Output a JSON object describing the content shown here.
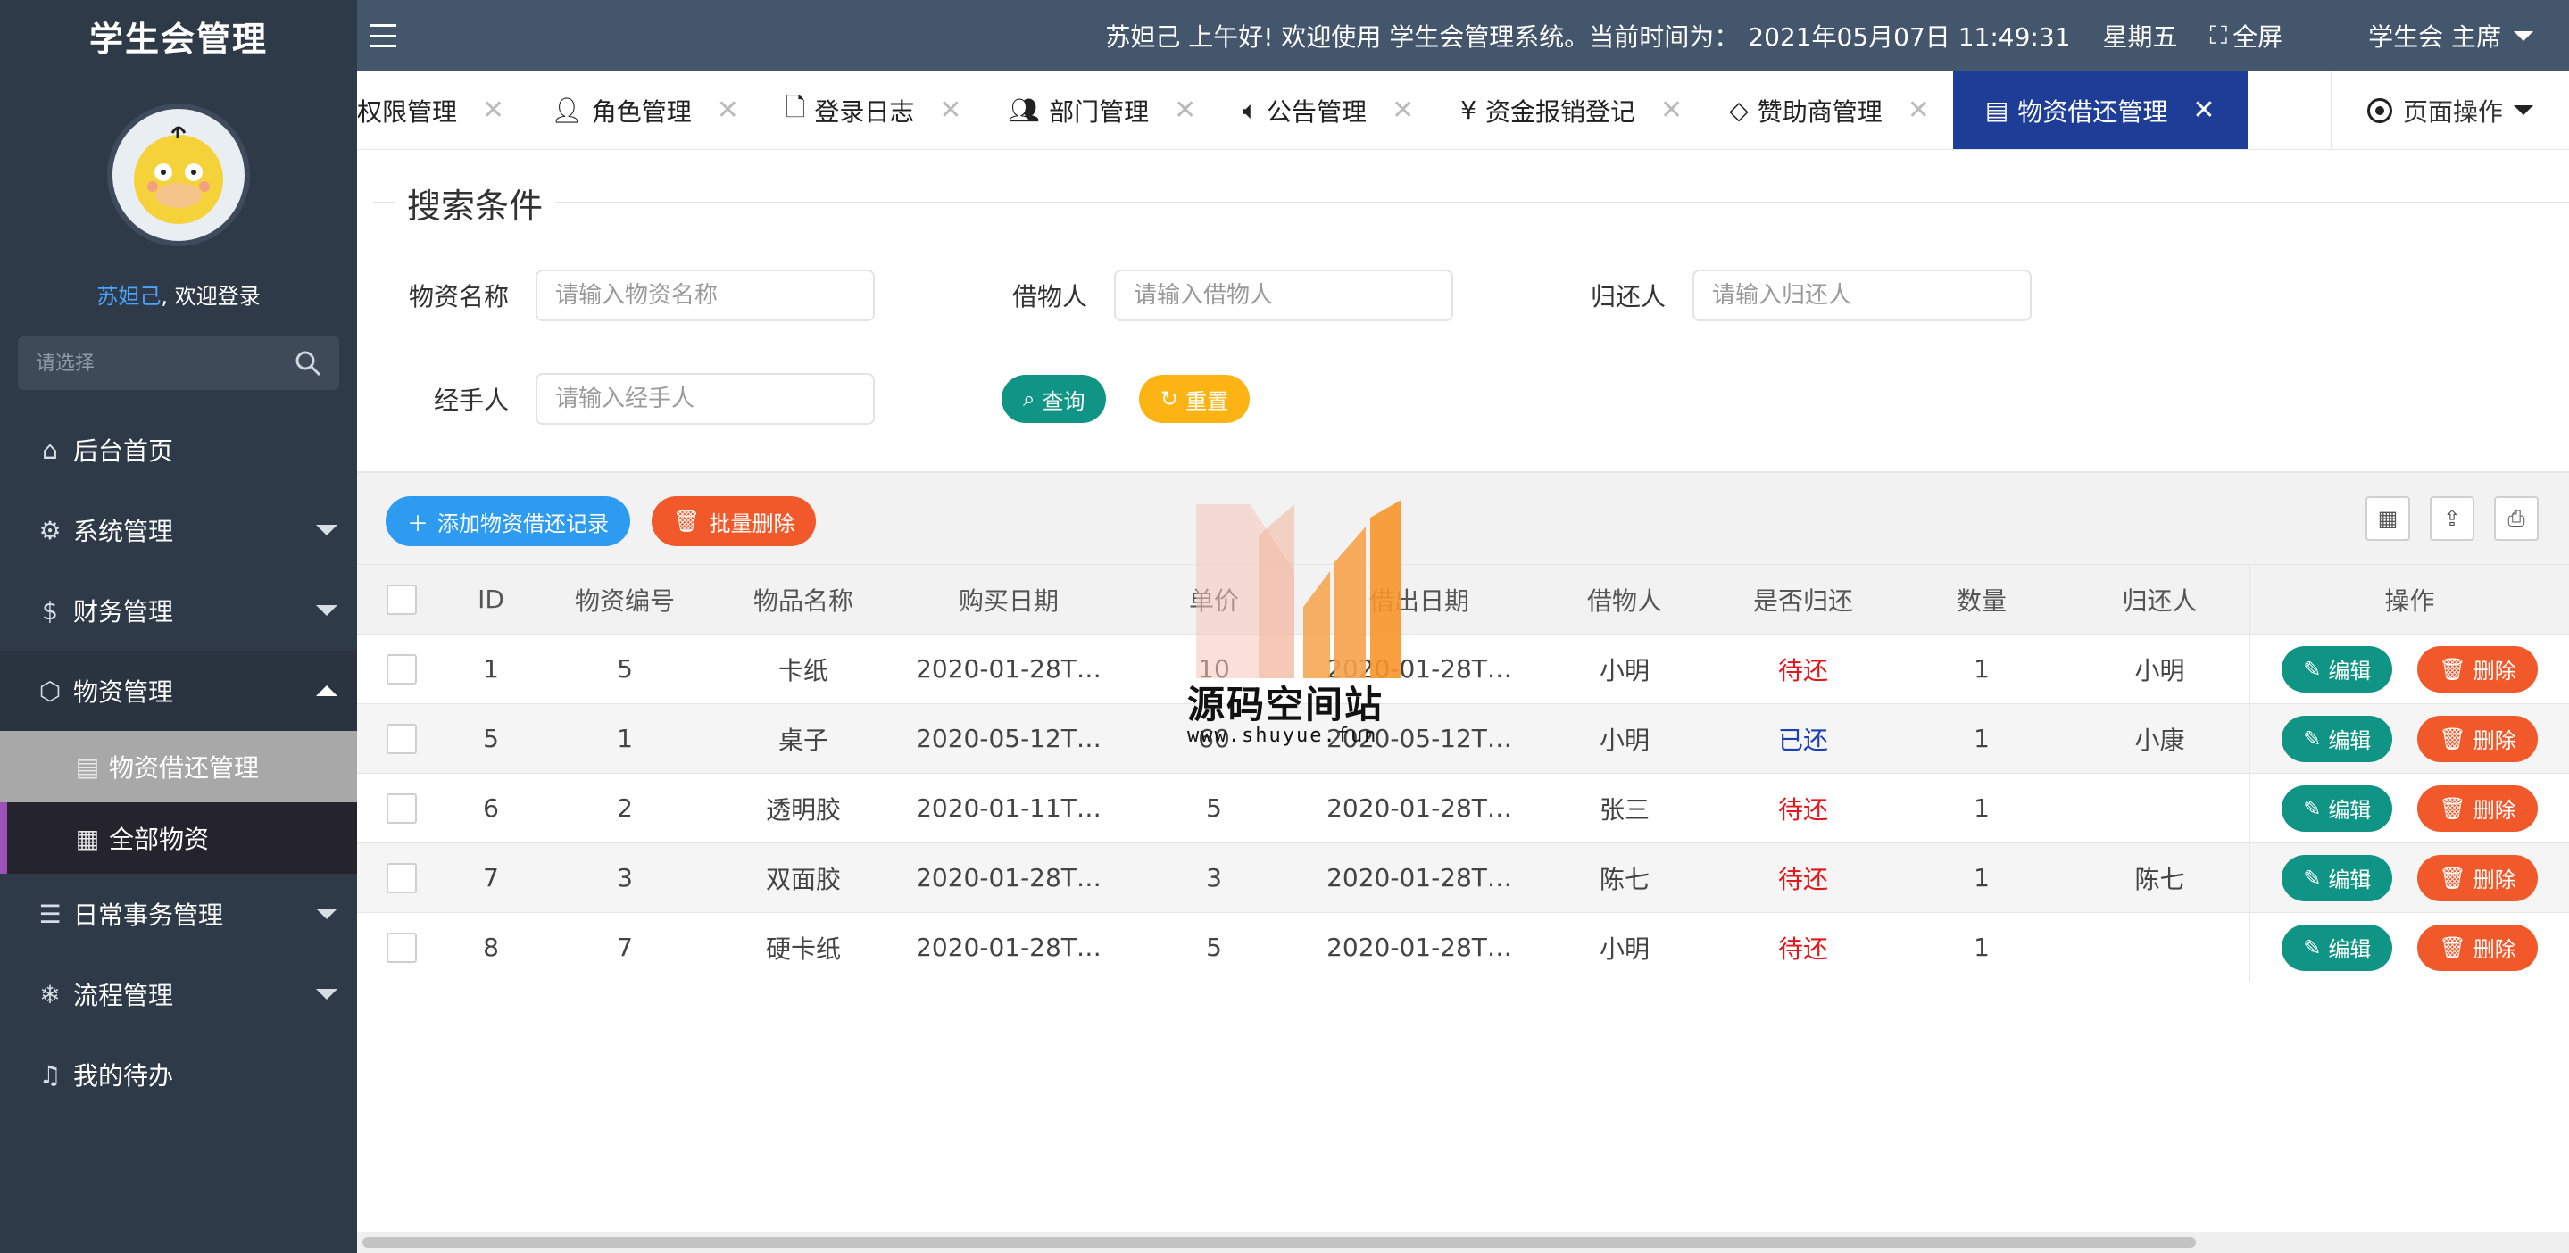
{
  "sidebar": {
    "brand": "学生会管理",
    "user_name": "苏妲己",
    "welcome_suffix": ", 欢迎登录",
    "search_placeholder": "请选择",
    "menu": [
      {
        "label": "后台首页",
        "icon": "home-icon"
      },
      {
        "label": "系统管理",
        "icon": "gear-icon"
      },
      {
        "label": "财务管理",
        "icon": "dollar-icon"
      },
      {
        "label": "物资管理",
        "icon": "cube-icon"
      },
      {
        "label": "日常事务管理",
        "icon": "sliders-icon"
      },
      {
        "label": "流程管理",
        "icon": "snowflake-icon"
      },
      {
        "label": "我的待办",
        "icon": "bell-icon"
      }
    ],
    "submenu": [
      {
        "label": "物资借还管理",
        "icon": "clipboard-icon"
      },
      {
        "label": "全部物资",
        "icon": "grid-icon"
      }
    ]
  },
  "topbar": {
    "greeting": "苏妲己 上午好!  欢迎使用 学生会管理系统。当前时间为：",
    "datetime": "2021年05月07日 11:49:31",
    "weekday": "星期五",
    "fullscreen": "全屏",
    "user_role": "学生会 主席"
  },
  "tabs": [
    {
      "label": "权限管理",
      "icon": ""
    },
    {
      "label": "角色管理",
      "icon": "user-icon"
    },
    {
      "label": "登录日志",
      "icon": "file-icon"
    },
    {
      "label": "部门管理",
      "icon": "users-icon"
    },
    {
      "label": "公告管理",
      "icon": "speaker-icon"
    },
    {
      "label": "资金报销登记",
      "icon": "yen-icon"
    },
    {
      "label": "赞助商管理",
      "icon": "diamond-icon"
    },
    {
      "label": "物资借还管理",
      "icon": "clipboard-icon"
    }
  ],
  "page_ops": "页面操作",
  "search": {
    "legend": "搜索条件",
    "material_name_label": "物资名称",
    "material_name_placeholder": "请输入物资名称",
    "borrower_label": "借物人",
    "borrower_placeholder": "请输入借物人",
    "returner_label": "归还人",
    "returner_placeholder": "请输入归还人",
    "handler_label": "经手人",
    "handler_placeholder": "请输入经手人",
    "query_btn": "查询",
    "reset_btn": "重置"
  },
  "toolbar": {
    "add_btn": "添加物资借还记录",
    "batch_delete_btn": "批量删除"
  },
  "table": {
    "columns": [
      "ID",
      "物资编号",
      "物品名称",
      "购买日期",
      "单价",
      "借出日期",
      "借物人",
      "是否归还",
      "数量",
      "归还人",
      "操作"
    ],
    "rows": [
      {
        "id": "1",
        "code": "5",
        "name": "卡纸",
        "buy_date": "2020-01-28T…",
        "price": "10",
        "lend_date": "2020-01-28T…",
        "borrower": "小明",
        "returned": "待还",
        "qty": "1",
        "returner": "小明"
      },
      {
        "id": "5",
        "code": "1",
        "name": "桌子",
        "buy_date": "2020-05-12T…",
        "price": "60",
        "lend_date": "2020-05-12T…",
        "borrower": "小明",
        "returned": "已还",
        "qty": "1",
        "returner": "小康"
      },
      {
        "id": "6",
        "code": "2",
        "name": "透明胶",
        "buy_date": "2020-01-11T…",
        "price": "5",
        "lend_date": "2020-01-28T…",
        "borrower": "张三",
        "returned": "待还",
        "qty": "1",
        "returner": ""
      },
      {
        "id": "7",
        "code": "3",
        "name": "双面胶",
        "buy_date": "2020-01-28T…",
        "price": "3",
        "lend_date": "2020-01-28T…",
        "borrower": "陈七",
        "returned": "待还",
        "qty": "1",
        "returner": "陈七"
      },
      {
        "id": "8",
        "code": "7",
        "name": "硬卡纸",
        "buy_date": "2020-01-28T…",
        "price": "5",
        "lend_date": "2020-01-28T…",
        "borrower": "小明",
        "returned": "待还",
        "qty": "1",
        "returner": ""
      }
    ],
    "edit_label": "编辑",
    "delete_label": "删除"
  },
  "watermark": {
    "title": "源码空间站",
    "url": "www.shuyue.fun"
  },
  "colors": {
    "sidebar_bg": "#2f3a48",
    "topbar_bg": "#44566c",
    "active_tab": "#1e3d96",
    "teal": "#109485",
    "orange_red": "#f1592a",
    "yellow": "#fbb414",
    "blue": "#2d9cf0",
    "pending_red": "#e5161b",
    "returned_blue": "#1d3fb6"
  }
}
